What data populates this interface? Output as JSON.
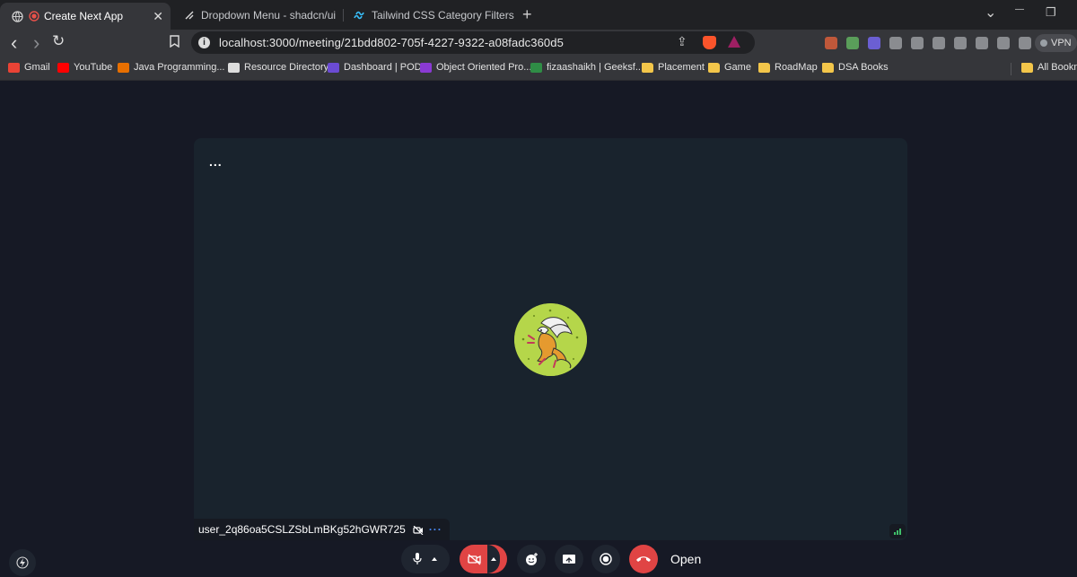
{
  "tabs": [
    {
      "title": "Create Next App",
      "active": true
    },
    {
      "title": "Dropdown Menu - shadcn/ui",
      "active": false
    },
    {
      "title": "Tailwind CSS Category Filters - Offic",
      "active": false
    }
  ],
  "tab_close": "✕",
  "new_tab": "+",
  "window": {
    "dropdown": "⌄",
    "minimize": "—",
    "restore": "❐"
  },
  "nav": {
    "back": "‹",
    "forward": "›",
    "reload": "↻",
    "bookmark": "⌑"
  },
  "omnibox": {
    "url": "localhost:3000/meeting/21bdd802-705f-4227-9322-a08fadc360d5",
    "info": "i",
    "share": "⇪"
  },
  "extensions": {
    "items": [
      {
        "name": "lx",
        "color": "#c0583a"
      },
      {
        "name": "robot",
        "color": "#5a9e5a"
      },
      {
        "name": "grid",
        "color": "#6b5fd3"
      },
      {
        "name": "media",
        "color": "#8a8c90"
      },
      {
        "name": "camera",
        "color": "#8a8c90"
      },
      {
        "name": "note",
        "color": "#8a8c90"
      },
      {
        "name": "puzzle",
        "color": "#8a8c90"
      },
      {
        "name": "sidebar",
        "color": "#8a8c90"
      },
      {
        "name": "wallet",
        "color": "#8a8c90"
      },
      {
        "name": "leo",
        "color": "#8a8c90"
      }
    ],
    "vpn": "VPN"
  },
  "bookmarks": [
    {
      "label": "Gmail",
      "color": "#ea4335",
      "folder": false
    },
    {
      "label": "YouTube",
      "color": "#ff0000",
      "folder": false
    },
    {
      "label": "Java Programming...",
      "color": "#e76f00",
      "folder": false
    },
    {
      "label": "Resource Directory",
      "color": "#dddddd",
      "folder": false
    },
    {
      "label": "Dashboard | POD",
      "color": "#6b4bd3",
      "folder": false
    },
    {
      "label": "Object Oriented Pro...",
      "color": "#8a3ad3",
      "folder": false
    },
    {
      "label": "fizaashaikh | Geeksf...",
      "color": "#2f8d46",
      "folder": false
    },
    {
      "label": "Placement",
      "color": "#f3c64a",
      "folder": true
    },
    {
      "label": "Game",
      "color": "#f3c64a",
      "folder": true
    },
    {
      "label": "RoadMap",
      "color": "#f3c64a",
      "folder": true
    },
    {
      "label": "DSA Books",
      "color": "#f3c64a",
      "folder": true
    }
  ],
  "all_bookmarks": "All Bookma",
  "meeting": {
    "tile_menu": "...",
    "participant_name": "user_2q86oa5CSLZSbLmBKg52hGWR725",
    "participant_more": "···",
    "controls": {
      "open_label": "Open"
    }
  },
  "colors": {
    "page_bg": "#161925",
    "tile_bg": "#19232d",
    "danger": "#e04444",
    "avatar_bg": "#b5d64a",
    "accent_blue": "#4a8cff"
  }
}
